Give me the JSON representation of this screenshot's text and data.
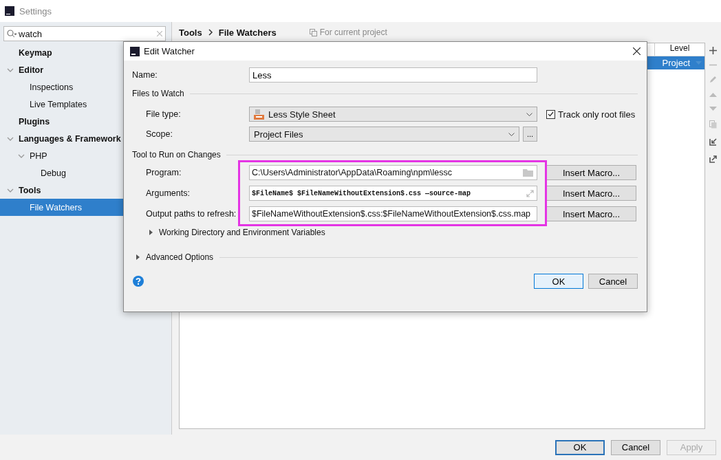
{
  "window": {
    "title": "Settings"
  },
  "search": {
    "value": "watch"
  },
  "sidebar": {
    "items": [
      {
        "label": "Keymap",
        "selected": false
      },
      {
        "label": "Editor",
        "expanded": true,
        "selected": false,
        "children": [
          {
            "label": "Inspections",
            "selected": false
          },
          {
            "label": "Live Templates",
            "selected": false
          }
        ]
      },
      {
        "label": "Plugins",
        "selected": false
      },
      {
        "label": "Languages & Framework",
        "expanded": true,
        "selected": false,
        "children": [
          {
            "label": "PHP",
            "expanded": true,
            "selected": false,
            "children": [
              {
                "label": "Debug",
                "selected": false
              }
            ]
          }
        ]
      },
      {
        "label": "Tools",
        "expanded": true,
        "selected": false,
        "children": [
          {
            "label": "File Watchers",
            "selected": true
          }
        ]
      }
    ]
  },
  "breadcrumb": [
    "Tools",
    "File Watchers"
  ],
  "scope_note": "For current project",
  "table": {
    "columns": [
      "Level"
    ],
    "rows": [
      {
        "level": "Project",
        "selected": true
      }
    ]
  },
  "buttons": [
    {
      "label": "OK",
      "kind": "default",
      "disabled": false
    },
    {
      "label": "Cancel",
      "kind": "normal",
      "disabled": false
    },
    {
      "label": "Apply",
      "kind": "normal",
      "disabled": true
    }
  ],
  "dialog": {
    "title": "Edit Watcher",
    "name": {
      "label": "Name:",
      "value": "Less"
    },
    "files_section": "Files to Watch",
    "file_type": {
      "label": "File type:",
      "value": "Less Style Sheet"
    },
    "track_root": {
      "label": "Track only root files",
      "checked": true
    },
    "scope": {
      "label": "Scope:",
      "value": "Project Files",
      "browse": "..."
    },
    "tool_section": "Tool to Run on Changes",
    "tool_fields": [
      {
        "kind": "program",
        "label": "Program:",
        "value": "C:\\Users\\Administrator\\AppData\\Roaming\\npm\\lessc",
        "macro": "Insert Macro..."
      },
      {
        "kind": "arguments",
        "label": "Arguments:",
        "value": "$FileName$ $FileNameWithoutExtension$.css —source-map",
        "macro": "Insert Macro..."
      },
      {
        "kind": "output",
        "label": "Output paths to refresh:",
        "value": "$FileNameWithoutExtension$.css:$FileNameWithoutExtension$.css.map",
        "macro": "Insert Macro..."
      }
    ],
    "working_dir": {
      "label": "Working Directory and Environment Variables",
      "expanded": false
    },
    "advanced": {
      "label": "Advanced Options",
      "expanded": false
    },
    "ok": "OK",
    "cancel": "Cancel"
  }
}
